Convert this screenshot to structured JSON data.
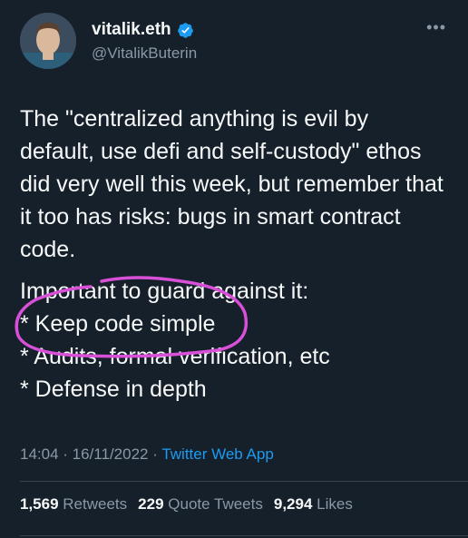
{
  "user": {
    "name": "vitalik.eth",
    "handle": "@VitalikButerin",
    "verified_color": "#1d9bf0"
  },
  "menu_icon": "more-horizontal-icon",
  "tweet": {
    "paragraph1": "The \"centralized anything is evil by default, use defi and self-custody\" ethos did very well this week, but remember that it too has risks: bugs in smart contract code.",
    "paragraph2_lines": [
      "Important to guard against it:",
      "* Keep code simple",
      "* Audits, formal verification, etc",
      "* Defense in depth"
    ]
  },
  "meta": {
    "time": "14:04",
    "date": "16/11/2022",
    "source": "Twitter Web App"
  },
  "stats": {
    "retweets_count": "1,569",
    "retweets_label": "Retweets",
    "quotes_count": "229",
    "quotes_label": "Quote Tweets",
    "likes_count": "9,294",
    "likes_label": "Likes"
  },
  "annotation_color": "#d84fd8"
}
